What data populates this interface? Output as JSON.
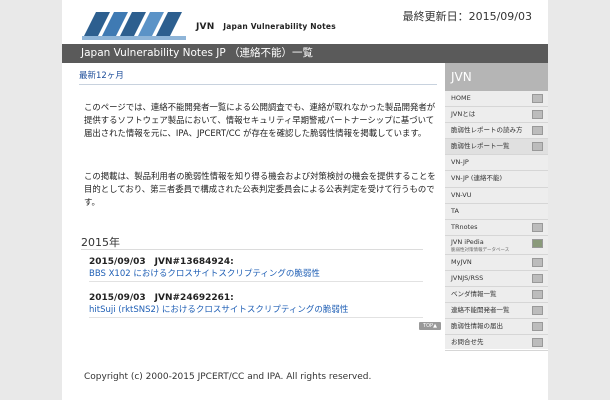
{
  "header": {
    "logo_mark": "JVN",
    "logo_subtitle": "Japan Vulnerability Notes",
    "last_updated": "最終更新日：2015/09/03"
  },
  "title_bar": "Japan Vulnerability Notes JP （連絡不能）一覧",
  "main": {
    "recent_label": "最新12ヶ月",
    "paragraph1": "このページでは、連絡不能開発者一覧による公開調査でも、連絡が取れなかった製品開発者が提供するソフトウェア製品において、情報セキュリティ早期警戒パートナーシップに基づいて届出された情報を元に、IPA、JPCERT/CC が存在を確認した脆弱性情報を掲載しています。",
    "paragraph2": "この掲載は、製品利用者の脆弱性情報を知り得る機会および対策検討の機会を提供することを目的としており、第三者委員で構成された公表判定委員会による公表判定を受けて行うものです。",
    "year": "2015年",
    "entries": [
      {
        "date_id": "2015/09/03　JVN#13684924:",
        "title": "BBS X102 におけるクロスサイトスクリプティングの脆弱性"
      },
      {
        "date_id": "2015/09/03　JVN#24692261:",
        "title": "hitSuji (rktSNS2) におけるクロスサイトスクリプティングの脆弱性"
      }
    ],
    "top_button": "TOP▲"
  },
  "sidebar": {
    "heading": "JVN",
    "items": [
      {
        "label": "HOME",
        "icon": "grid-icon"
      },
      {
        "label": "JVNとは",
        "icon": "grid-icon"
      },
      {
        "label": "脆弱性レポートの読み方",
        "icon": "grid-icon"
      },
      {
        "label": "脆弱性レポート一覧",
        "icon": "grid-icon"
      },
      {
        "label": "VN-JP",
        "icon": ""
      },
      {
        "label": "VN-JP (連絡不能)",
        "icon": ""
      },
      {
        "label": "VN-VU",
        "icon": ""
      },
      {
        "label": "TA",
        "icon": ""
      },
      {
        "label": "TRnotes",
        "icon": "download-icon"
      },
      {
        "label": "JVN iPedia",
        "sub": "脆弱性対策情報データベース",
        "icon": "grid-icon"
      },
      {
        "label": "MyJVN",
        "icon": "grid-icon"
      },
      {
        "label": "JVNJS/RSS",
        "icon": "grid-icon"
      },
      {
        "label": "ベンダ情報一覧",
        "icon": "grid-icon"
      },
      {
        "label": "連絡不能開発者一覧",
        "icon": "grid-icon"
      },
      {
        "label": "脆弱性情報の届出",
        "icon": "grid-icon"
      },
      {
        "label": "お問合せ先",
        "icon": "grid-icon"
      }
    ]
  },
  "footer": "Copyright (c) 2000-2015 JPCERT/CC and IPA. All rights reserved."
}
